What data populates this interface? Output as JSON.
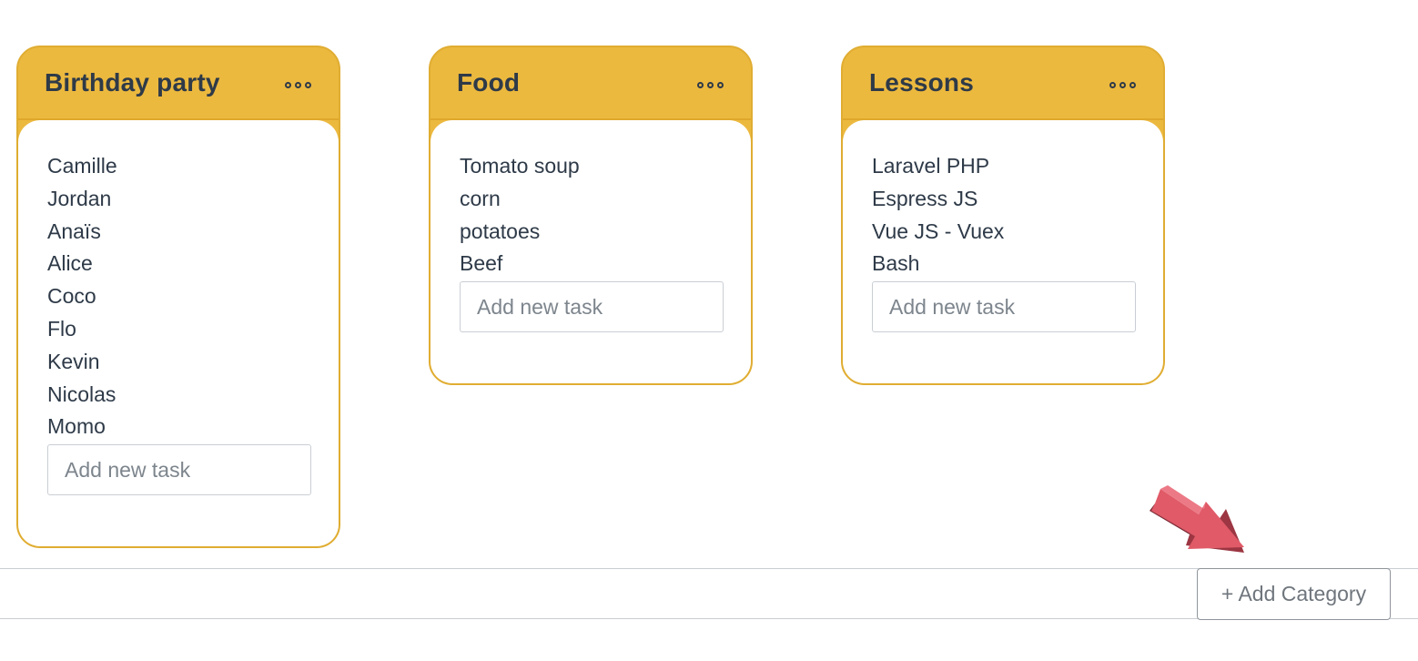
{
  "board": {
    "categories": [
      {
        "title": "Birthday party",
        "tasks": [
          "Camille",
          "Jordan",
          "Anaïs",
          "Alice",
          "Coco",
          "Flo",
          "Kevin",
          "Nicolas",
          "Momo"
        ],
        "input_placeholder": "Add new task"
      },
      {
        "title": "Food",
        "tasks": [
          "Tomato soup",
          "corn",
          "potatoes",
          "Beef"
        ],
        "input_placeholder": "Add new task"
      },
      {
        "title": "Lessons",
        "tasks": [
          "Laravel PHP",
          "Espress JS",
          "Vue JS - Vuex",
          "Bash"
        ],
        "input_placeholder": "Add new task"
      }
    ],
    "add_category_label": "+ Add Category"
  },
  "colors": {
    "card_header": "#ecb93f",
    "card_border": "#e0ad32",
    "text": "#2e3a48",
    "arrow": "#e05a68",
    "arrow_shadow": "#7a2a34"
  },
  "icons": {
    "card_menu": "more-dots-icon",
    "pointer": "arrow-pointer-icon"
  }
}
